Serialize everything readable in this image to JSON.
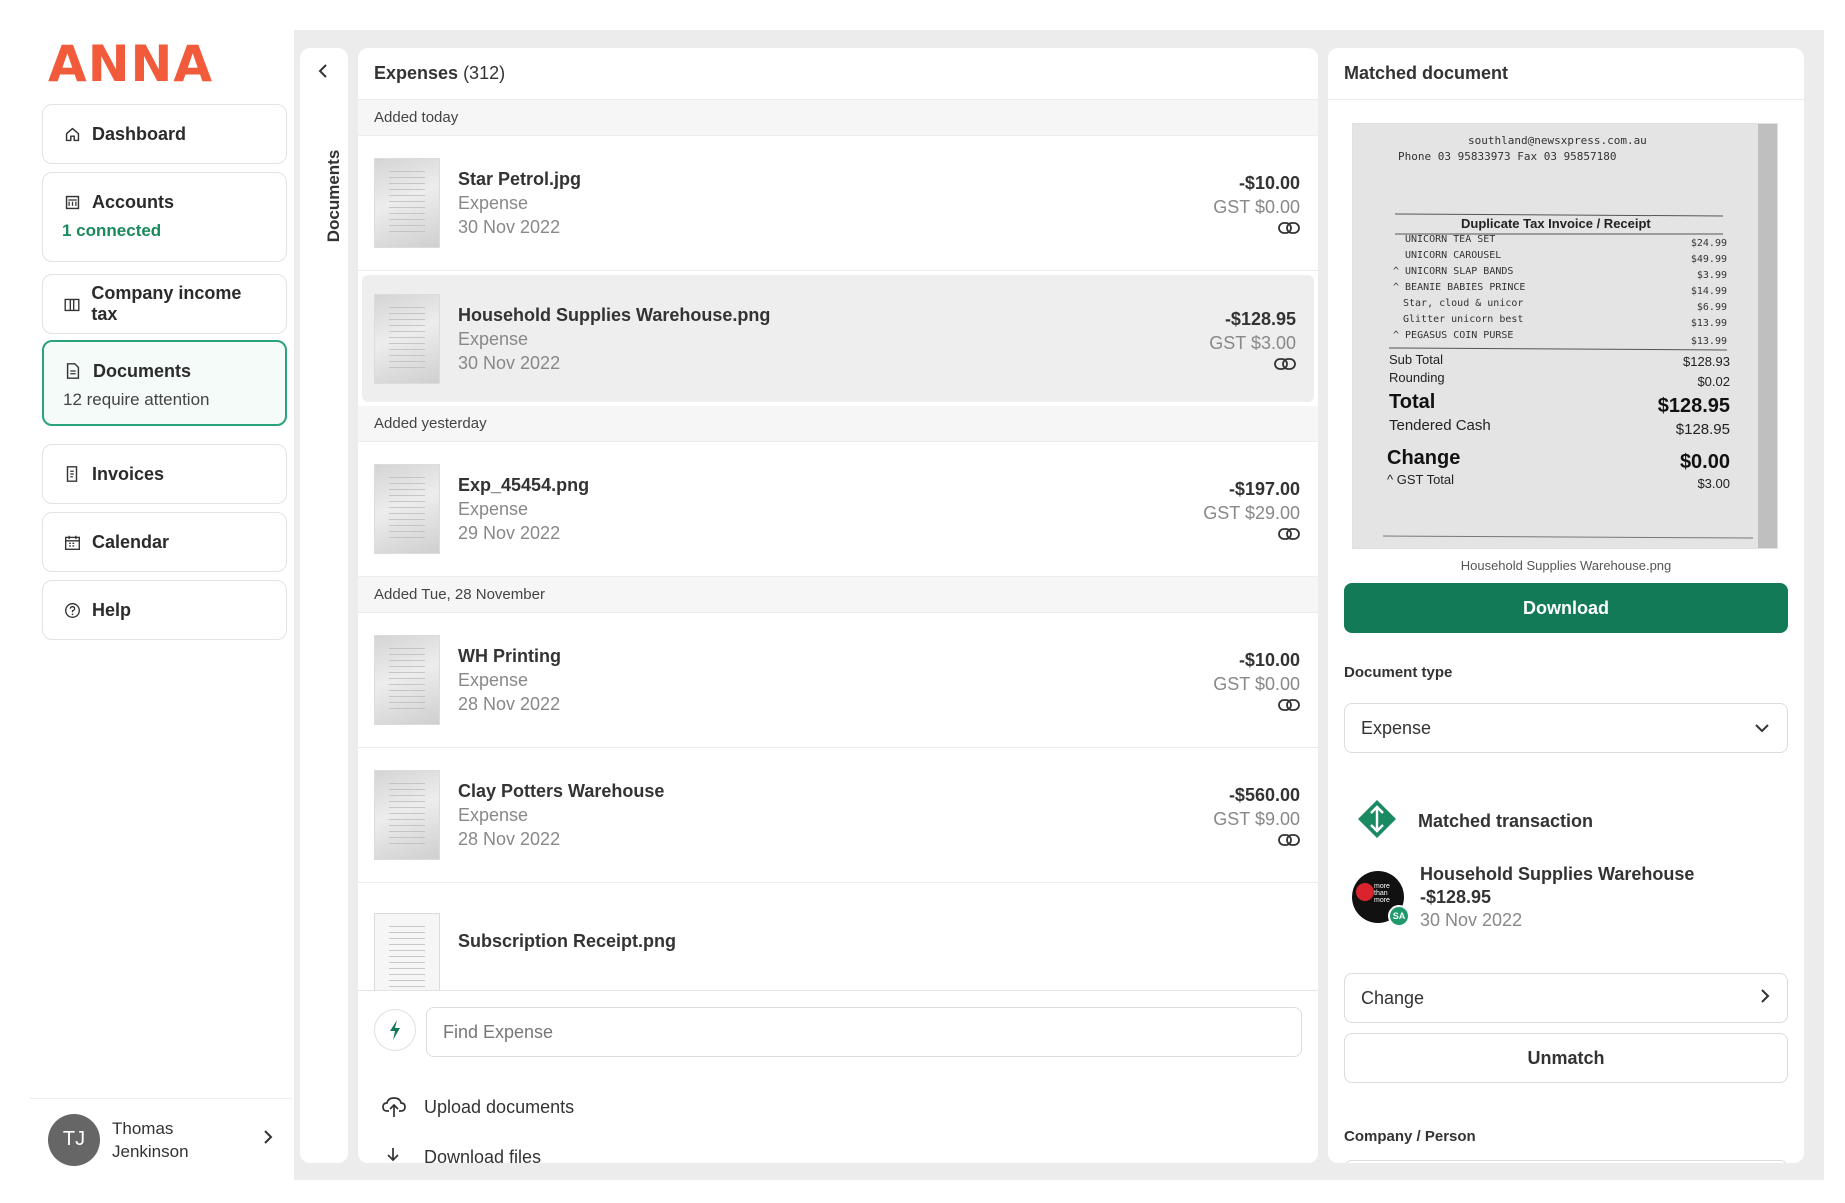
{
  "app": {
    "logo": "ANNA"
  },
  "sidebar": {
    "items": [
      {
        "label": "Dashboard",
        "icon": "home-icon"
      },
      {
        "label": "Accounts",
        "sub": "1 connected",
        "icon": "bank-icon"
      },
      {
        "label": "Company income tax",
        "icon": "book-icon"
      },
      {
        "label": "Documents",
        "sub": "12 require attention",
        "icon": "document-icon",
        "active": true
      },
      {
        "label": "Invoices",
        "icon": "invoice-icon"
      },
      {
        "label": "Calendar",
        "icon": "calendar-icon"
      },
      {
        "label": "Help",
        "icon": "help-icon"
      }
    ],
    "user": {
      "initials": "TJ",
      "name": "Thomas Jenkinson"
    }
  },
  "collapse": {
    "label": "Documents"
  },
  "expenses": {
    "title": "Expenses",
    "count": "(312)",
    "groups": [
      {
        "label": "Added today"
      },
      {
        "label": "Added yesterday"
      },
      {
        "label": "Added Tue, 28 November"
      }
    ],
    "items": [
      {
        "name": "Star Petrol.jpg",
        "type": "Expense",
        "date": "30 Nov 2022",
        "amount": "-$10.00",
        "gst": "GST $0.00"
      },
      {
        "name": "Household Supplies Warehouse.png",
        "type": "Expense",
        "date": "30 Nov 2022",
        "amount": "-$128.95",
        "gst": "GST $3.00"
      },
      {
        "name": "Exp_45454.png",
        "type": "Expense",
        "date": "29 Nov 2022",
        "amount": "-$197.00",
        "gst": "GST $29.00"
      },
      {
        "name": "WH Printing",
        "type": "Expense",
        "date": "28 Nov 2022",
        "amount": "-$10.00",
        "gst": "GST $0.00"
      },
      {
        "name": "Clay Potters Warehouse",
        "type": "Expense",
        "date": "28 Nov 2022",
        "amount": "-$560.00",
        "gst": "GST $9.00"
      },
      {
        "name": "Subscription Receipt.png"
      }
    ],
    "find_placeholder": "Find Expense",
    "upload_label": "Upload documents",
    "download_files_label": "Download files"
  },
  "detail": {
    "title": "Matched document",
    "receipt": {
      "header": "southland@newsxpress.com.au",
      "phone": "Phone   03 95833973        Fax   03 95857180",
      "heading": "Duplicate Tax Invoice / Receipt",
      "lines": [
        {
          "item": "UNICORN TEA SET",
          "price": "$24.99"
        },
        {
          "item": "UNICORN CAROUSEL",
          "price": "$49.99"
        },
        {
          "item": "^ UNICORN SLAP BANDS",
          "price": "$3.99"
        },
        {
          "item": "^ BEANIE BABIES PRINCE",
          "price": "$14.99"
        },
        {
          "item": "Star, cloud & unicor",
          "price": "$6.99"
        },
        {
          "item": "Glitter unicorn best",
          "price": "$13.99"
        },
        {
          "item": "^ PEGASUS COIN PURSE",
          "price": "$13.99"
        }
      ],
      "subtotal_label": "Sub Total",
      "subtotal": "$128.93",
      "rounding_label": "Rounding",
      "rounding": "$0.02",
      "total_label": "Total",
      "total": "$128.95",
      "tendered_label": "Tendered Cash",
      "tendered": "$128.95",
      "change_label": "Change",
      "change": "$0.00",
      "gst_label": "^ GST Total",
      "gst": "$3.00"
    },
    "filename": "Household Supplies Warehouse.png",
    "download_label": "Download",
    "doc_type_label": "Document type",
    "doc_type_value": "Expense",
    "matched_label": "Matched transaction",
    "transaction": {
      "name": "Household Supplies Warehouse",
      "amount": "-$128.95",
      "date": "30 Nov 2022",
      "badge": "SA",
      "logo_text": "more than more"
    },
    "change_label": "Change",
    "unmatch_label": "Unmatch",
    "company_label": "Company / Person"
  },
  "colors": {
    "brand": "#f15a3a",
    "primary": "#137a57",
    "accent": "#2aa37a"
  }
}
